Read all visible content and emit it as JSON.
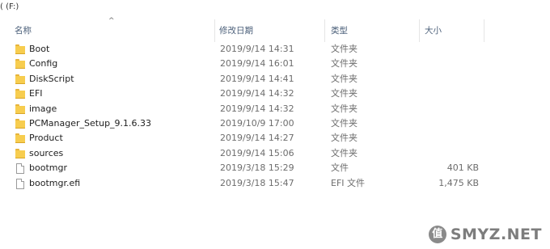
{
  "breadcrumb": "( (F:)",
  "columns": {
    "name": "名称",
    "date": "修改日期",
    "type": "类型",
    "size": "大小"
  },
  "files": [
    {
      "name": "Boot",
      "date": "2019/9/14 14:31",
      "type": "文件夹",
      "size": "",
      "icon": "folder-icon"
    },
    {
      "name": "Config",
      "date": "2019/9/14 16:01",
      "type": "文件夹",
      "size": "",
      "icon": "folder-icon"
    },
    {
      "name": "DiskScript",
      "date": "2019/9/14 14:41",
      "type": "文件夹",
      "size": "",
      "icon": "folder-icon"
    },
    {
      "name": "EFI",
      "date": "2019/9/14 14:32",
      "type": "文件夹",
      "size": "",
      "icon": "folder-icon"
    },
    {
      "name": "image",
      "date": "2019/9/14 14:32",
      "type": "文件夹",
      "size": "",
      "icon": "folder-icon"
    },
    {
      "name": "PCManager_Setup_9.1.6.33",
      "date": "2019/10/9 17:00",
      "type": "文件夹",
      "size": "",
      "icon": "folder-icon"
    },
    {
      "name": "Product",
      "date": "2019/9/14 14:27",
      "type": "文件夹",
      "size": "",
      "icon": "folder-icon"
    },
    {
      "name": "sources",
      "date": "2019/9/14 15:06",
      "type": "文件夹",
      "size": "",
      "icon": "folder-icon"
    },
    {
      "name": "bootmgr",
      "date": "2019/3/18 15:29",
      "type": "文件",
      "size": "401 KB",
      "icon": "file-icon"
    },
    {
      "name": "bootmgr.efi",
      "date": "2019/3/18 15:47",
      "type": "EFI 文件",
      "size": "1,475 KB",
      "icon": "file-icon"
    }
  ],
  "watermark": {
    "logo": "值",
    "text": "SMYZ.NET"
  }
}
